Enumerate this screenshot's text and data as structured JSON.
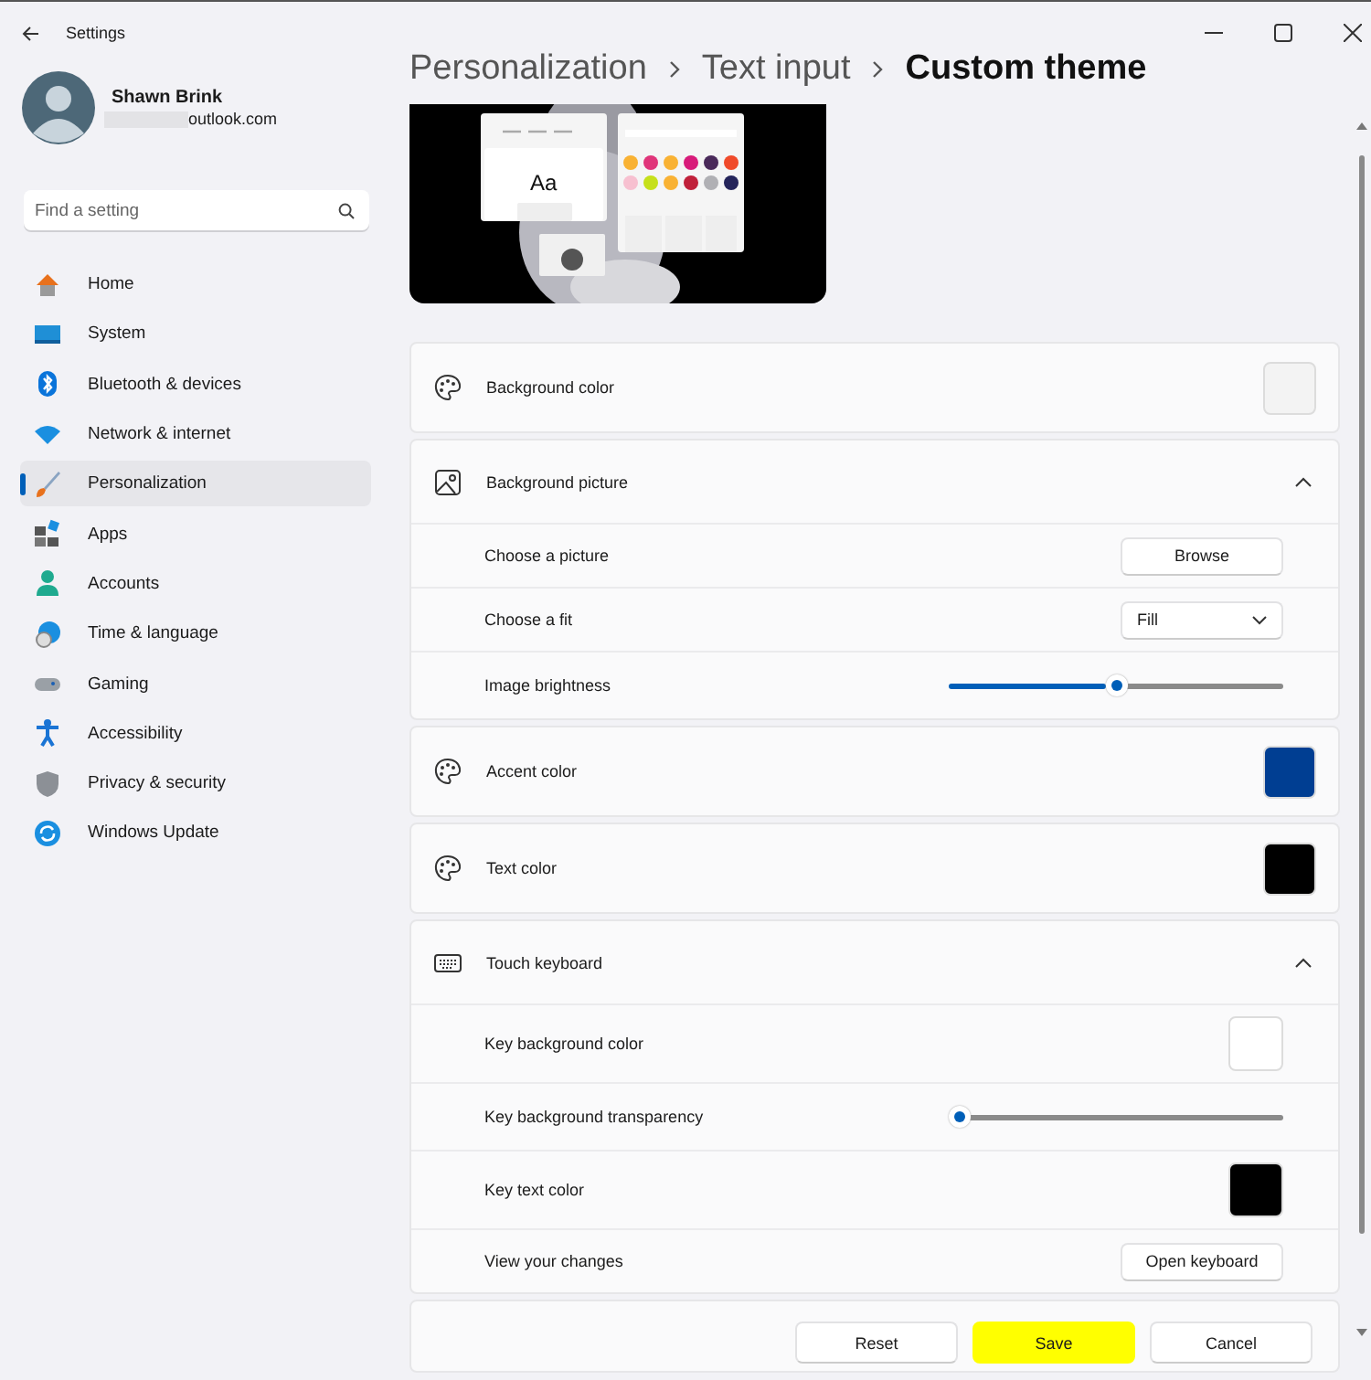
{
  "window": {
    "title": "Settings"
  },
  "user": {
    "name": "Shawn Brink",
    "email": "outlook.com"
  },
  "search": {
    "placeholder": "Find a setting"
  },
  "nav": [
    {
      "label": "Home",
      "selected": false
    },
    {
      "label": "System",
      "selected": false
    },
    {
      "label": "Bluetooth & devices",
      "selected": false
    },
    {
      "label": "Network & internet",
      "selected": false
    },
    {
      "label": "Personalization",
      "selected": true
    },
    {
      "label": "Apps",
      "selected": false
    },
    {
      "label": "Accounts",
      "selected": false
    },
    {
      "label": "Time & language",
      "selected": false
    },
    {
      "label": "Gaming",
      "selected": false
    },
    {
      "label": "Accessibility",
      "selected": false
    },
    {
      "label": "Privacy & security",
      "selected": false
    },
    {
      "label": "Windows Update",
      "selected": false
    }
  ],
  "breadcrumb": [
    "Personalization",
    "Text input",
    "Custom theme"
  ],
  "preview": {
    "sample_text": "Aa"
  },
  "groups": [
    {
      "kind": "color",
      "label": "Background color",
      "color": "#f3f3f3"
    },
    {
      "kind": "expander",
      "label": "Background picture",
      "expanded": true,
      "rows": [
        {
          "kind": "button",
          "label": "Choose a picture",
          "button": "Browse"
        },
        {
          "kind": "dropdown",
          "label": "Choose a fit",
          "value": "Fill"
        },
        {
          "kind": "slider",
          "label": "Image brightness",
          "level": 0.5
        }
      ]
    },
    {
      "kind": "color",
      "label": "Accent color",
      "color": "#003e92"
    },
    {
      "kind": "color",
      "label": "Text color",
      "color": "#000000"
    },
    {
      "kind": "expander",
      "label": "Touch keyboard",
      "expanded": true,
      "rows": [
        {
          "kind": "color",
          "label": "Key background color",
          "color": "#ffffff"
        },
        {
          "kind": "slider",
          "label": "Key background transparency",
          "level": 0
        },
        {
          "kind": "color",
          "label": "Key text color",
          "color": "#000000"
        },
        {
          "kind": "button",
          "label": "View your changes",
          "button": "Open keyboard"
        }
      ]
    }
  ],
  "footer_buttons": [
    {
      "label": "Reset",
      "highlighted": false
    },
    {
      "label": "Save",
      "highlighted": true
    },
    {
      "label": "Cancel",
      "highlighted": false
    }
  ]
}
